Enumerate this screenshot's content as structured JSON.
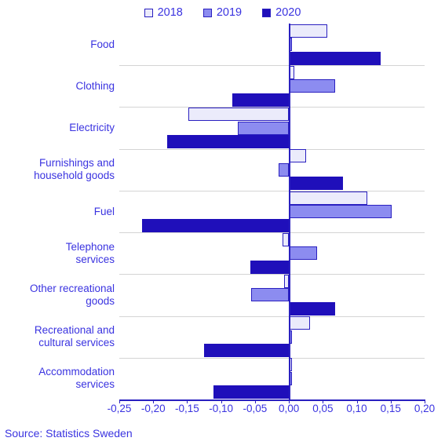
{
  "legend": {
    "items": [
      {
        "label": "2018",
        "color": "#ebebfb"
      },
      {
        "label": "2019",
        "color": "#8c8cf0"
      },
      {
        "label": "2020",
        "color": "#1f0fba"
      }
    ]
  },
  "source": {
    "text": "Source: Statistics Sweden"
  },
  "chart_data": {
    "type": "bar",
    "orientation": "horizontal",
    "title": "",
    "subtitle": "",
    "xlabel": "",
    "ylabel": "",
    "xlim": [
      -0.25,
      0.2
    ],
    "xticks": [
      -0.25,
      -0.2,
      -0.15,
      -0.1,
      -0.05,
      0.0,
      0.05,
      0.1,
      0.15,
      0.2
    ],
    "xticklabels": [
      "-0,25",
      "-0,20",
      "-0,15",
      "-0,10",
      "-0,05",
      "0,00",
      "0,05",
      "0,10",
      "0,15",
      "0,20"
    ],
    "grid": "horizontal-category-separators",
    "legend_position": "top-center",
    "categories": [
      "Food",
      "Clothing",
      "Electricity",
      "Furnishings and household goods",
      "Fuel",
      "Telephone services",
      "Other recreational goods",
      "Recreational and cultural services",
      "Accommodation services"
    ],
    "category_lines": [
      [
        "Food"
      ],
      [
        "Clothing"
      ],
      [
        "Electricity"
      ],
      [
        "Furnishings and",
        "household goods"
      ],
      [
        "Fuel"
      ],
      [
        "Telephone",
        "services"
      ],
      [
        "Other recreational",
        "goods"
      ],
      [
        "Recreational and",
        "cultural services"
      ],
      [
        "Accommodation",
        "services"
      ]
    ],
    "series": [
      {
        "name": "2018",
        "color": "#ebebfb",
        "values": [
          0.057,
          0.008,
          -0.148,
          0.025,
          0.115,
          -0.009,
          -0.007,
          0.031,
          0.004
        ]
      },
      {
        "name": "2019",
        "color": "#8c8cf0",
        "values": [
          0.004,
          0.068,
          -0.075,
          -0.015,
          0.151,
          0.041,
          -0.056,
          0.004,
          0.004
        ]
      },
      {
        "name": "2020",
        "color": "#1f0fba",
        "values": [
          0.135,
          -0.083,
          -0.18,
          0.08,
          -0.216,
          -0.057,
          0.068,
          -0.125,
          -0.111
        ]
      }
    ]
  }
}
